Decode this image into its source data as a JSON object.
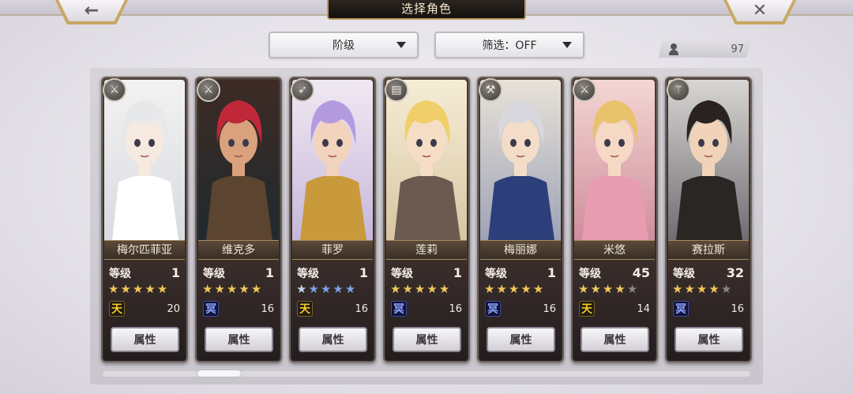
{
  "header": {
    "title": "选择角色",
    "back_icon": "←",
    "close_icon": "✕"
  },
  "filters": {
    "rank_label": "阶级",
    "filter_label": "筛选：OFF"
  },
  "roster_count": "97",
  "colors": {
    "gold_star": "#efc759",
    "grey_star": "#8b8580",
    "frame_gold": "#c8a862"
  },
  "cards": [
    {
      "name": "梅尔匹菲亚",
      "level_label": "等级",
      "level": "1",
      "stars": [
        "gold",
        "gold",
        "gold",
        "gold",
        "gold"
      ],
      "element": "天",
      "element_type": "tian",
      "count": "20",
      "attr_label": "属性",
      "class_icon": "sword-icon"
    },
    {
      "name": "维克多",
      "level_label": "等级",
      "level": "1",
      "stars": [
        "gold",
        "gold",
        "gold",
        "gold",
        "gold"
      ],
      "element": "冥",
      "element_type": "ming",
      "count": "16",
      "attr_label": "属性",
      "class_icon": "sword-icon"
    },
    {
      "name": "菲罗",
      "level_label": "等级",
      "level": "1",
      "stars": [
        "silver",
        "blue",
        "blue",
        "blue",
        "blue"
      ],
      "element": "天",
      "element_type": "tian",
      "count": "16",
      "attr_label": "属性",
      "class_icon": "bow-icon"
    },
    {
      "name": "莲莉",
      "level_label": "等级",
      "level": "1",
      "stars": [
        "gold",
        "gold",
        "gold",
        "gold",
        "gold"
      ],
      "element": "冥",
      "element_type": "ming",
      "count": "16",
      "attr_label": "属性",
      "class_icon": "book-icon"
    },
    {
      "name": "梅丽娜",
      "level_label": "等级",
      "level": "1",
      "stars": [
        "gold",
        "gold",
        "gold",
        "gold",
        "gold"
      ],
      "element": "冥",
      "element_type": "ming",
      "count": "16",
      "attr_label": "属性",
      "class_icon": "hammer-icon"
    },
    {
      "name": "米悠",
      "level_label": "等级",
      "level": "45",
      "stars": [
        "gold",
        "gold",
        "gold",
        "gold",
        "grey"
      ],
      "element": "天",
      "element_type": "tian",
      "count": "14",
      "attr_label": "属性",
      "class_icon": "sword-icon"
    },
    {
      "name": "赛拉斯",
      "level_label": "等级",
      "level": "32",
      "stars": [
        "gold",
        "gold",
        "gold",
        "gold",
        "grey"
      ],
      "element": "冥",
      "element_type": "ming",
      "count": "16",
      "attr_label": "属性",
      "class_icon": "staff-icon"
    }
  ]
}
